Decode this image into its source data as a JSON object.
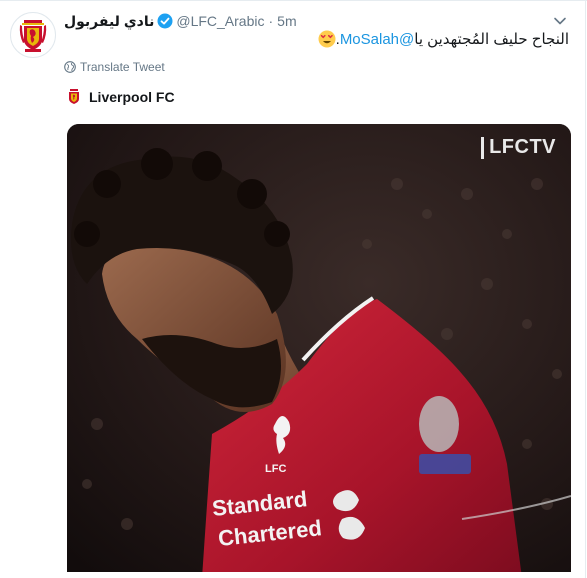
{
  "tweet": {
    "author_name": "نادي ليفربول",
    "handle": "@LFC_Arabic",
    "separator": "·",
    "time": "5m",
    "text_main": "النجاح حليف المُجتهدين يا ",
    "mention": "@MoSalah",
    "text_end": ".",
    "translate_label": "Translate Tweet"
  },
  "card": {
    "source_name": "Liverpool FC",
    "video_watermark": "LFCTV"
  },
  "icons": {
    "avatar": "liverpool-crest-icon",
    "verified": "verified-badge-icon",
    "menu": "chevron-down-icon",
    "translate": "globe-icon",
    "emoji": "heart-eyes-emoji-icon"
  },
  "colors": {
    "link": "#1b95e0",
    "muted": "#657786",
    "verified": "#1da1f2",
    "lfc_red": "#c8102e"
  }
}
